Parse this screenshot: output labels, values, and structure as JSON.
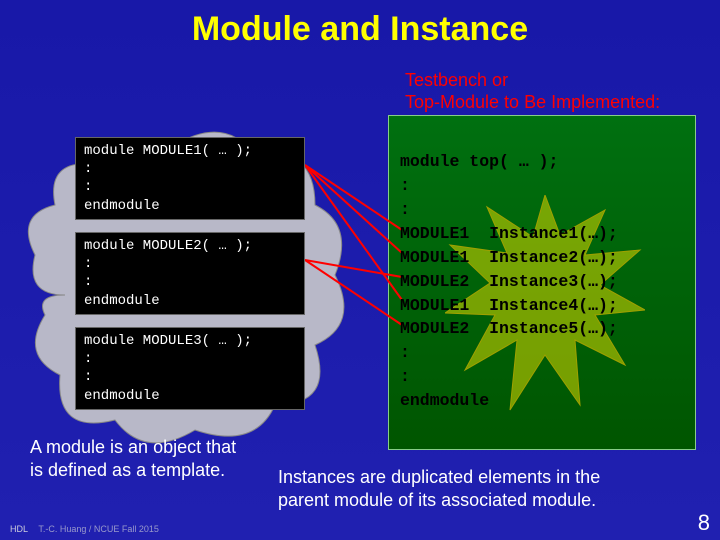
{
  "title": "Module and Instance",
  "subtitle": "Testbench or\nTop-Module to Be Implemented:",
  "modules": {
    "m1": "module MODULE1( … );\n:\n:\nendmodule",
    "m2": "module MODULE2( … );\n:\n:\nendmodule",
    "m3": "module MODULE3( … );\n:\n:\nendmodule"
  },
  "top_code": "module top( … );\n:\n:\nMODULE1  Instance1(…);\nMODULE1  Instance2(…);\nMODULE2  Instance3(…);\nMODULE1  Instance4(…);\nMODULE2  Instance5(…);\n:\n:\nendmodule",
  "caption1": "A module is an object that\nis defined as a template.",
  "caption2": "Instances are duplicated elements in the\nparent module of its associated module.",
  "footer_left": "HDL",
  "footer_text": "T.-C. Huang / NCUE  Fall 2015",
  "page_number": "8"
}
